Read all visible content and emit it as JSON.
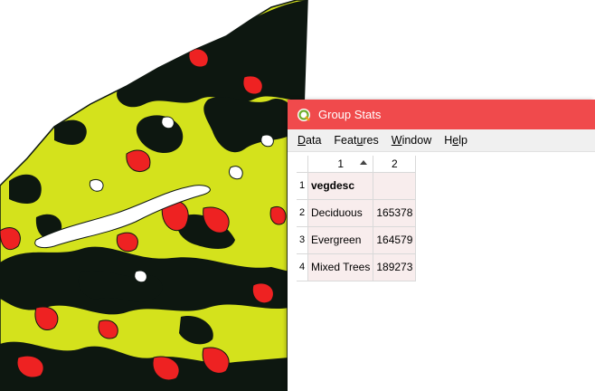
{
  "window": {
    "title": "Group Stats",
    "accent": "#f04a4c",
    "icon": "qgis-logo-icon"
  },
  "menu": {
    "data": {
      "u": "D",
      "rest": "ata"
    },
    "features": {
      "pre": "Feat",
      "u": "u",
      "rest": "res"
    },
    "window": {
      "u": "W",
      "rest": "indow"
    },
    "help": {
      "pre": "H",
      "u": "e",
      "rest": "lp"
    }
  },
  "table": {
    "col_headers": [
      "1",
      "2"
    ],
    "row_headers": [
      "1",
      "2",
      "3",
      "4"
    ],
    "rows": [
      [
        "vegdesc",
        ""
      ],
      [
        "Deciduous",
        "165378"
      ],
      [
        "Evergreen",
        "164579"
      ],
      [
        "Mixed Trees",
        "189273"
      ]
    ]
  },
  "map": {
    "colors": {
      "black": "#0d1710",
      "yellow_green": "#d4e21c",
      "red": "#ee2222",
      "white": "#ffffff"
    }
  }
}
